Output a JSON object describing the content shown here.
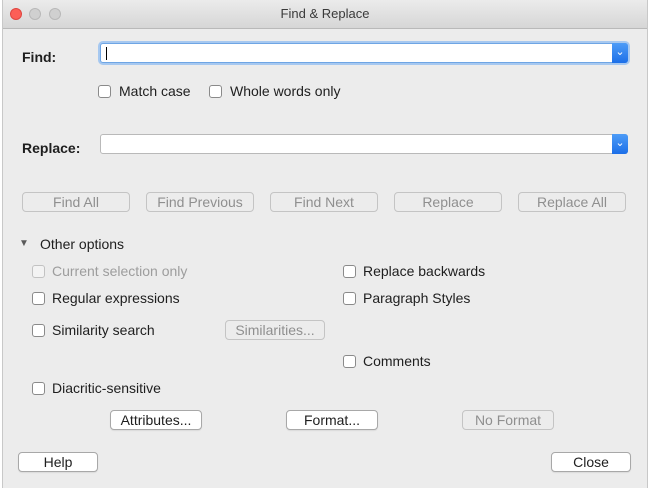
{
  "window": {
    "title": "Find & Replace"
  },
  "find": {
    "label": "Find:",
    "value": "",
    "dropdown_icon": "chevron-down-icon"
  },
  "options": {
    "match_case": "Match case",
    "whole_words": "Whole words only"
  },
  "replace": {
    "label": "Replace:",
    "value": "",
    "dropdown_icon": "chevron-down-icon"
  },
  "actions": {
    "find_all": "Find All",
    "find_previous": "Find Previous",
    "find_next": "Find Next",
    "replace": "Replace",
    "replace_all": "Replace All"
  },
  "other_options": {
    "header": "Other options",
    "current_selection_only": "Current selection only",
    "replace_backwards": "Replace backwards",
    "regular_expressions": "Regular expressions",
    "paragraph_styles": "Paragraph Styles",
    "similarity_search": "Similarity search",
    "similarities_button": "Similarities...",
    "comments": "Comments",
    "diacritic_sensitive": "Diacritic-sensitive",
    "attributes_button": "Attributes...",
    "format_button": "Format...",
    "no_format_button": "No Format"
  },
  "footer": {
    "help": "Help",
    "close": "Close"
  },
  "colors": {
    "accent": "#1c6fe8",
    "close_light": "#fc5f57"
  }
}
